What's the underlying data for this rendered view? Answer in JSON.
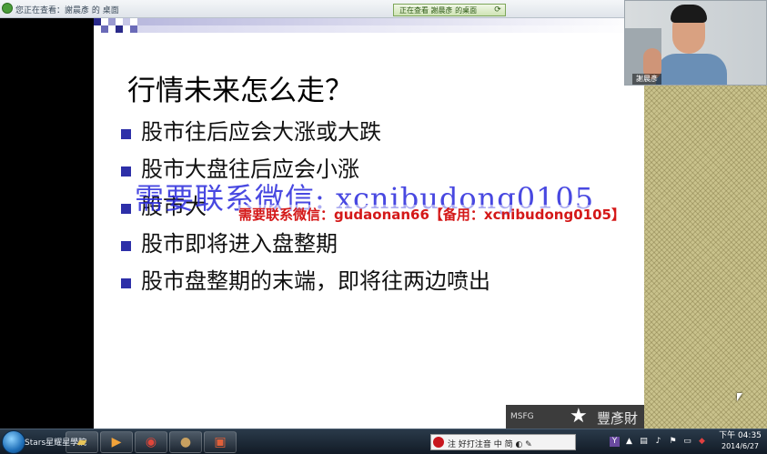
{
  "window": {
    "title": "您正在查看：謝晨彥 的 桌面",
    "share_indicator": "正在查看 謝晨彥 的桌面"
  },
  "slide": {
    "title": "行情未来怎么走？",
    "bullets": [
      "股市往后应会大涨或大跌",
      "股市大盘往后应会小涨",
      "股市大",
      "股市即将进入盘整期",
      "股市盘整期的末端，即将往两边喷出"
    ],
    "logo_text": "MSFG",
    "logo_text2": "豐彥財"
  },
  "watermarks": {
    "blue": "需要联系微信: xcnibudong0105",
    "red": "需要联系微信：gudaonan66【备用：xcnibudong0105】"
  },
  "webcam": {
    "name_tag": "謝晨彥"
  },
  "taskbar": {
    "start_label": "Stars星耀星學院",
    "ime_text": "注 好打注音  中  简  ◐  ✎",
    "time": "下午 04:35",
    "date": "2014/6/27"
  },
  "colors": {
    "bullet": "#2d2fa8",
    "watermark_blue": "#2828dc",
    "watermark_red": "#d41818",
    "panel": "#c9c28c"
  }
}
